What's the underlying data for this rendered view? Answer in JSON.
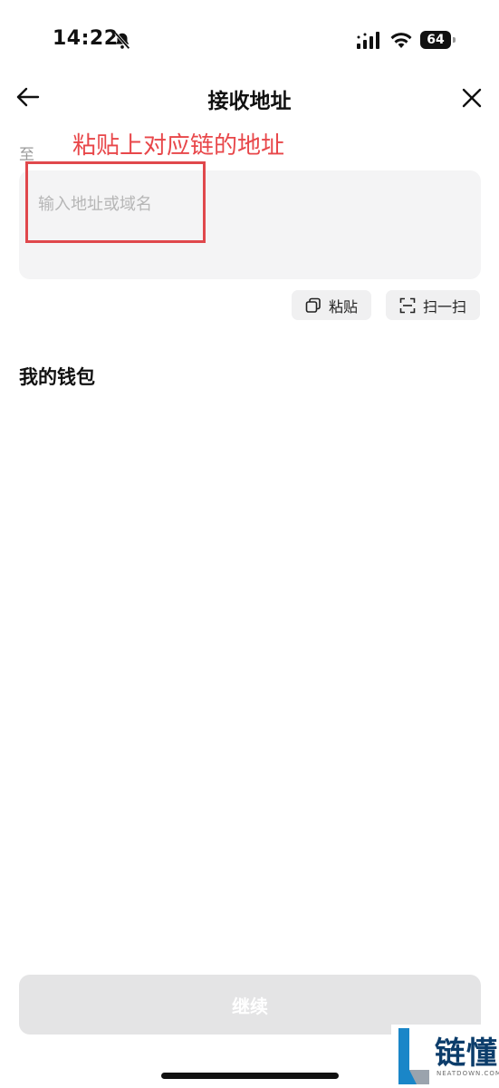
{
  "status_bar": {
    "time": "14:22",
    "battery": "64"
  },
  "nav": {
    "title": "接收地址"
  },
  "form": {
    "to_label": "至",
    "address_placeholder": "输入地址或域名",
    "paste_label": "粘贴",
    "scan_label": "扫一扫"
  },
  "annotation": {
    "text": "粘贴上对应链的地址",
    "color": "#e8474a"
  },
  "wallets": {
    "section_title": "我的钱包"
  },
  "footer": {
    "continue_label": "继续"
  },
  "watermark": {
    "brand": "链懂",
    "site": "NEATDOWN.COM"
  },
  "colors": {
    "annotation_red": "#e0484c",
    "input_bg": "#f4f4f5",
    "disabled_button": "#e4e4e5"
  }
}
